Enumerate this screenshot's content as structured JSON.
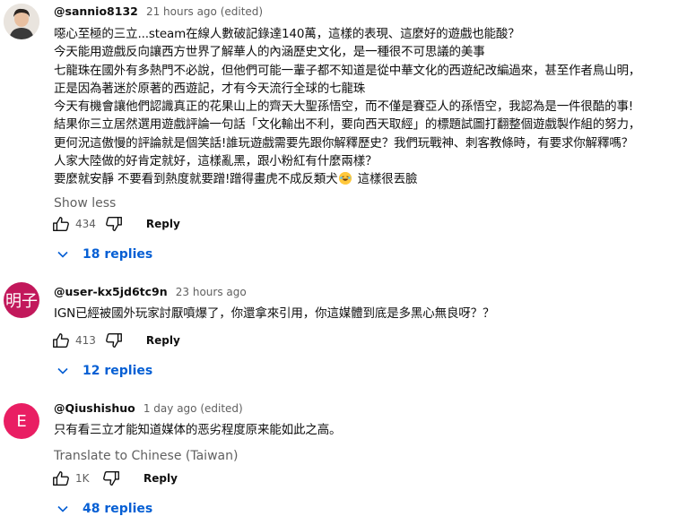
{
  "comments": [
    {
      "author": "@sannio8132",
      "time": "21 hours ago (edited)",
      "lines": [
        "噁心至極的三立...steam在線人數破記錄達140萬，這樣的表現、這麼好的遊戲也能酸？",
        "今天能用遊戲反向讓西方世界了解華人的內涵歷史文化，是一種很不可思議的美事",
        "七龍珠在國外有多熱門不必說，但他們可能一輩子都不知道是從中華文化的西遊紀改編過來，甚至作者鳥山明，",
        "正是因為著迷於原著的西遊記，才有今天流行全球的七龍珠",
        "今天有機會讓他們認識真正的花果山上的齊天大聖孫悟空，而不僅是賽亞人的孫悟空，我認為是一件很酷的事!",
        "結果你三立居然選用遊戲評論一句話「文化輸出不利，要向西天取經」的標題試圖打翻整個遊戲製作組的努力，",
        "更何況這傲慢的評論就是個笑話!誰玩遊戲需要先跟你解釋歷史？我們玩戰神、刺客教條時，有要求你解釋嗎？",
        "人家大陸做的好肯定就好，這樣亂黑，跟小粉紅有什麼兩樣？"
      ],
      "last_line_before": "要麼就安靜 不要看到熱度就要蹭!蹭得畫虎不成反類犬",
      "last_line_after": " 這樣很丟臉",
      "show_less": "Show less",
      "likes": "434",
      "reply_label": "Reply",
      "replies": "18 replies"
    },
    {
      "author": "@user-kx5jd6tc9n",
      "time": "23 hours ago",
      "avatar_text": "明子",
      "avatar_color": "#c2185b",
      "lines": [
        "IGN已經被國外玩家討厭噴爆了，你還拿來引用，你這媒體到底是多黑心無良呀？？"
      ],
      "likes": "413",
      "reply_label": "Reply",
      "replies": "12 replies"
    },
    {
      "author": "@Qiushishuo",
      "time": "1 day ago (edited)",
      "avatar_text": "E",
      "avatar_color": "#e91e63",
      "lines": [
        "只有看三立才能知道媒体的恶劣程度原来能如此之高。"
      ],
      "translate": "Translate to Chinese (Taiwan)",
      "likes": "1K",
      "reply_label": "Reply",
      "replies": "48 replies"
    }
  ],
  "colors": {
    "accent": "#065fd4",
    "secondary_text": "#606060"
  },
  "icons": [
    "like-icon",
    "dislike-icon",
    "chevron-down-icon",
    "laughing-emoji"
  ]
}
